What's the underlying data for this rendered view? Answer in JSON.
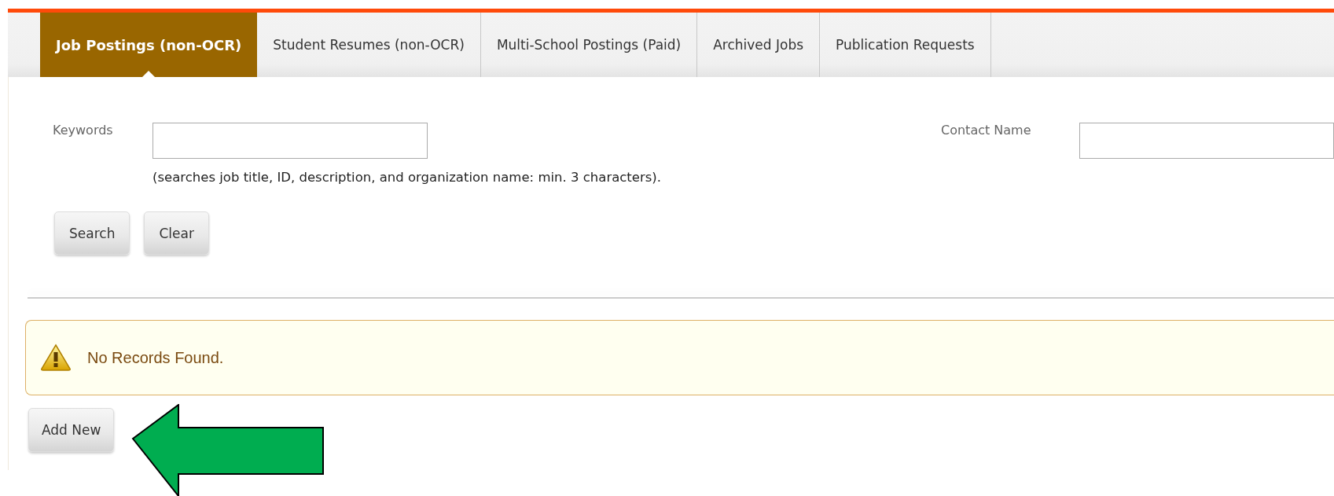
{
  "tabs": [
    {
      "label": "Job Postings (non-OCR)",
      "selected": true
    },
    {
      "label": "Student Resumes (non-OCR)",
      "selected": false
    },
    {
      "label": "Multi-School Postings (Paid)",
      "selected": false
    },
    {
      "label": "Archived Jobs",
      "selected": false
    },
    {
      "label": "Publication Requests",
      "selected": false
    }
  ],
  "search": {
    "keywords_label": "Keywords",
    "contact_label": "Contact Name",
    "hint": "(searches job title, ID, description, and organization name: min. 3 characters).",
    "buttons": [
      "Search",
      "Clear"
    ]
  },
  "alert": {
    "message": "No Records Found."
  },
  "add_button": "Add New"
}
